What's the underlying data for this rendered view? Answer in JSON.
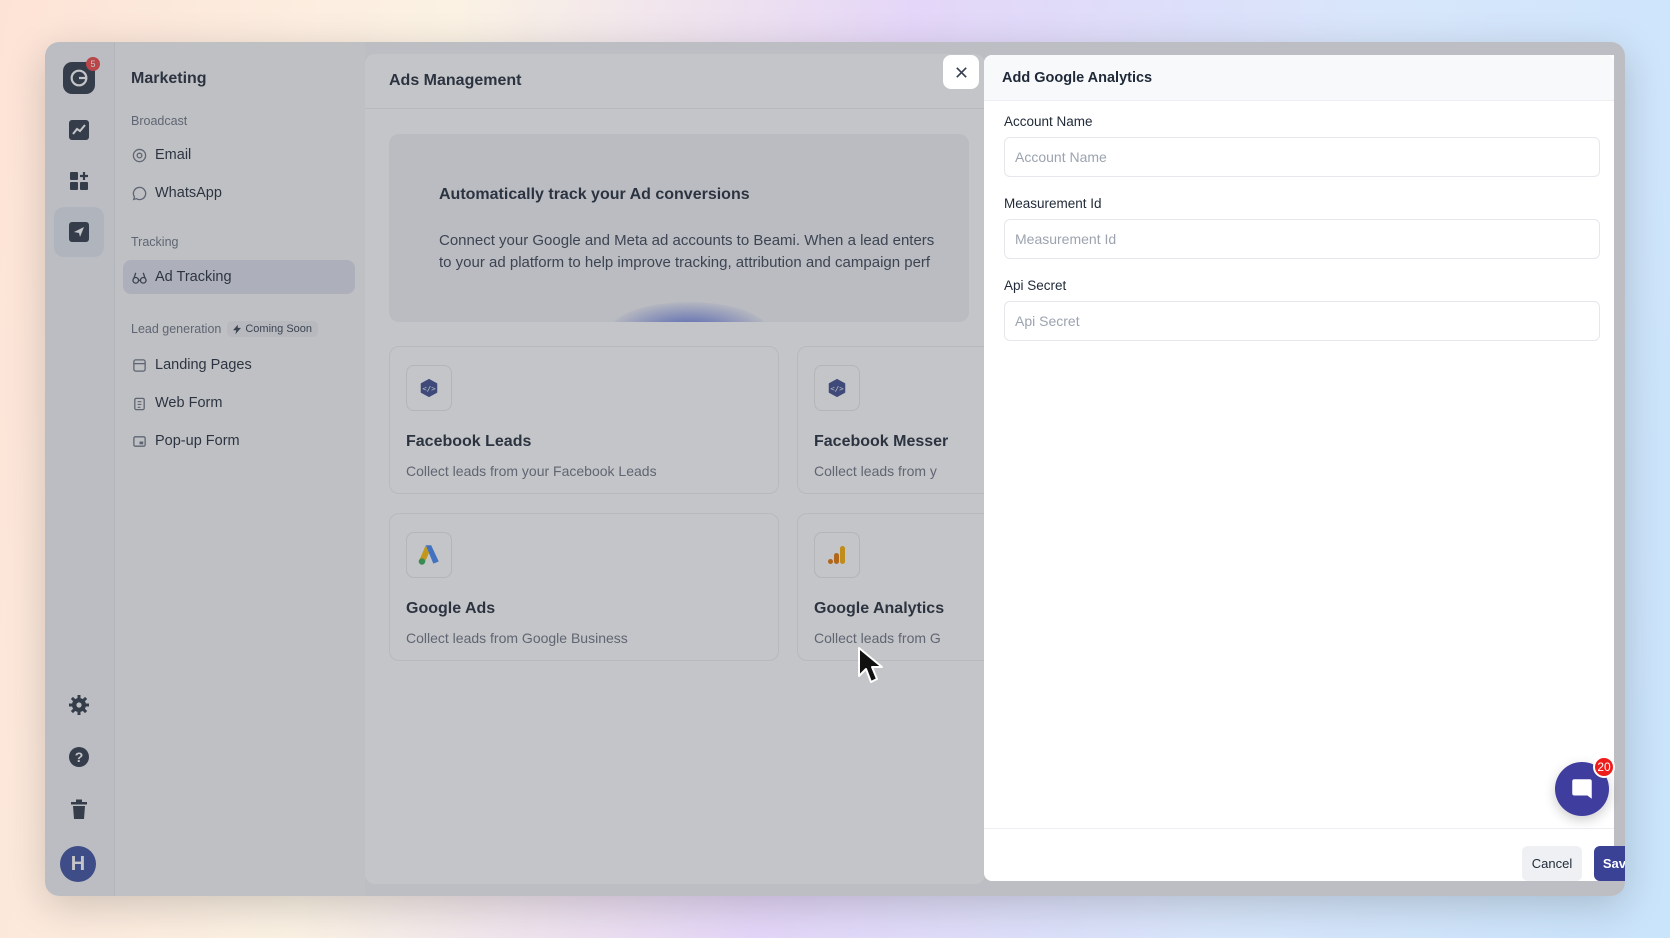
{
  "rail": {
    "logo_badge": "5",
    "avatar_initial": "H",
    "icons": [
      "analytics-icon",
      "apps-icon",
      "send-icon",
      "gear-icon",
      "help-icon",
      "trash-icon"
    ]
  },
  "sidebar": {
    "title": "Marketing",
    "broadcast_label": "Broadcast",
    "broadcast_items": [
      {
        "label": "Email",
        "icon": "at-icon"
      },
      {
        "label": "WhatsApp",
        "icon": "whatsapp-icon"
      }
    ],
    "tracking_label": "Tracking",
    "tracking_items": [
      {
        "label": "Ad Tracking",
        "icon": "glasses-icon",
        "active": true
      }
    ],
    "leadgen_label": "Lead generation",
    "coming_soon": "Coming Soon",
    "leadgen_items": [
      {
        "label": "Landing Pages",
        "icon": "page-icon"
      },
      {
        "label": "Web Form",
        "icon": "clipboard-icon"
      },
      {
        "label": "Pop-up Form",
        "icon": "popup-icon"
      }
    ]
  },
  "main": {
    "title": "Ads Management",
    "hero_title": "Automatically track your Ad conversions",
    "hero_line1": "Connect your Google and Meta ad accounts to Beami. When a lead enters",
    "hero_line2": "to your ad platform to help improve tracking, attribution and campaign perf",
    "cards": [
      {
        "title": "Facebook Leads",
        "desc": "Collect leads from your Facebook Leads"
      },
      {
        "title": "Facebook Messer",
        "desc": "Collect leads from y"
      },
      {
        "title": "Google Ads",
        "desc": "Collect leads from Google Business"
      },
      {
        "title": "Google Analytics",
        "desc": "Collect leads from G"
      }
    ]
  },
  "modal": {
    "title": "Add Google Analytics",
    "fields": [
      {
        "label": "Account Name",
        "placeholder": "Account Name",
        "value": ""
      },
      {
        "label": "Measurement Id",
        "placeholder": "Measurement Id",
        "value": ""
      },
      {
        "label": "Api Secret",
        "placeholder": "Api Secret",
        "value": ""
      }
    ],
    "cancel_label": "Cancel",
    "save_label": "Save"
  },
  "chat": {
    "badge": "20"
  },
  "colors": {
    "accent": "#3a4296",
    "chat": "#3f3d9e",
    "badge": "#ef1c1c",
    "active_bg": "#dde1ec"
  }
}
